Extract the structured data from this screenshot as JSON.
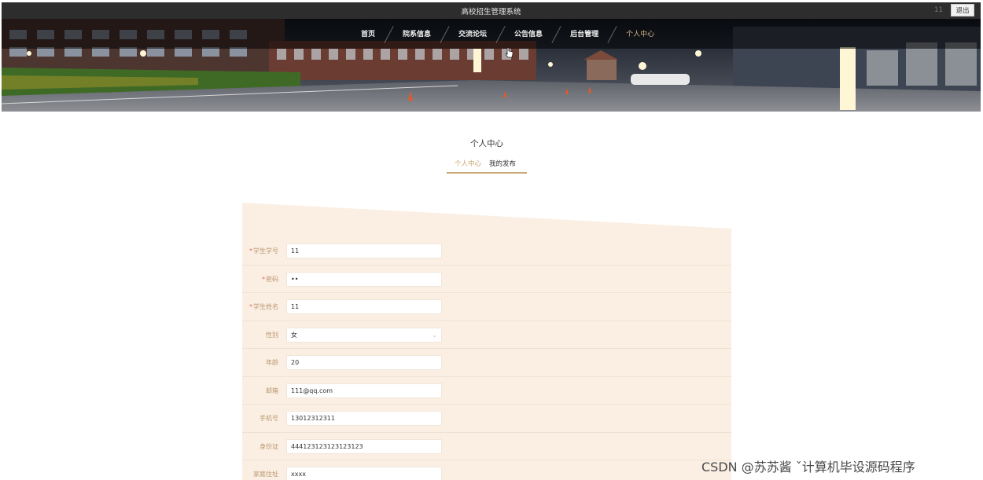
{
  "app": {
    "title": "高校招生管理系统",
    "user_name": "11",
    "logout_label": "退出"
  },
  "nav": {
    "items": [
      {
        "label": "首页",
        "active": false
      },
      {
        "label": "院系信息",
        "active": false
      },
      {
        "label": "交流论坛",
        "active": false
      },
      {
        "label": "公告信息",
        "active": false
      },
      {
        "label": "后台管理",
        "active": false
      },
      {
        "label": "个人中心",
        "active": true
      }
    ]
  },
  "section": {
    "title": "个人中心",
    "tabs": [
      {
        "label": "个人中心",
        "active": true
      },
      {
        "label": "我的发布",
        "active": false
      }
    ]
  },
  "form": {
    "fields": [
      {
        "label": "学生学号",
        "required": true,
        "value": "11"
      },
      {
        "label": "密码",
        "required": true,
        "value": "••"
      },
      {
        "label": "学生姓名",
        "required": true,
        "value": "11"
      },
      {
        "label": "性别",
        "required": false,
        "value": "女",
        "type": "select"
      },
      {
        "label": "年龄",
        "required": false,
        "value": "20"
      },
      {
        "label": "邮箱",
        "required": false,
        "value": "111@qq.com"
      },
      {
        "label": "手机号",
        "required": false,
        "value": "13012312311"
      },
      {
        "label": "身份证",
        "required": false,
        "value": "444123123123123123"
      },
      {
        "label": "家庭住址",
        "required": false,
        "value": "xxxx"
      }
    ]
  },
  "watermark": "CSDN @苏苏酱   ˇ计算机毕设源码程序",
  "colors": {
    "topbar": "#2d2d2d",
    "accent": "#c9ab78",
    "panel_bg": "#fbeee3",
    "required": "#e26a6a"
  }
}
